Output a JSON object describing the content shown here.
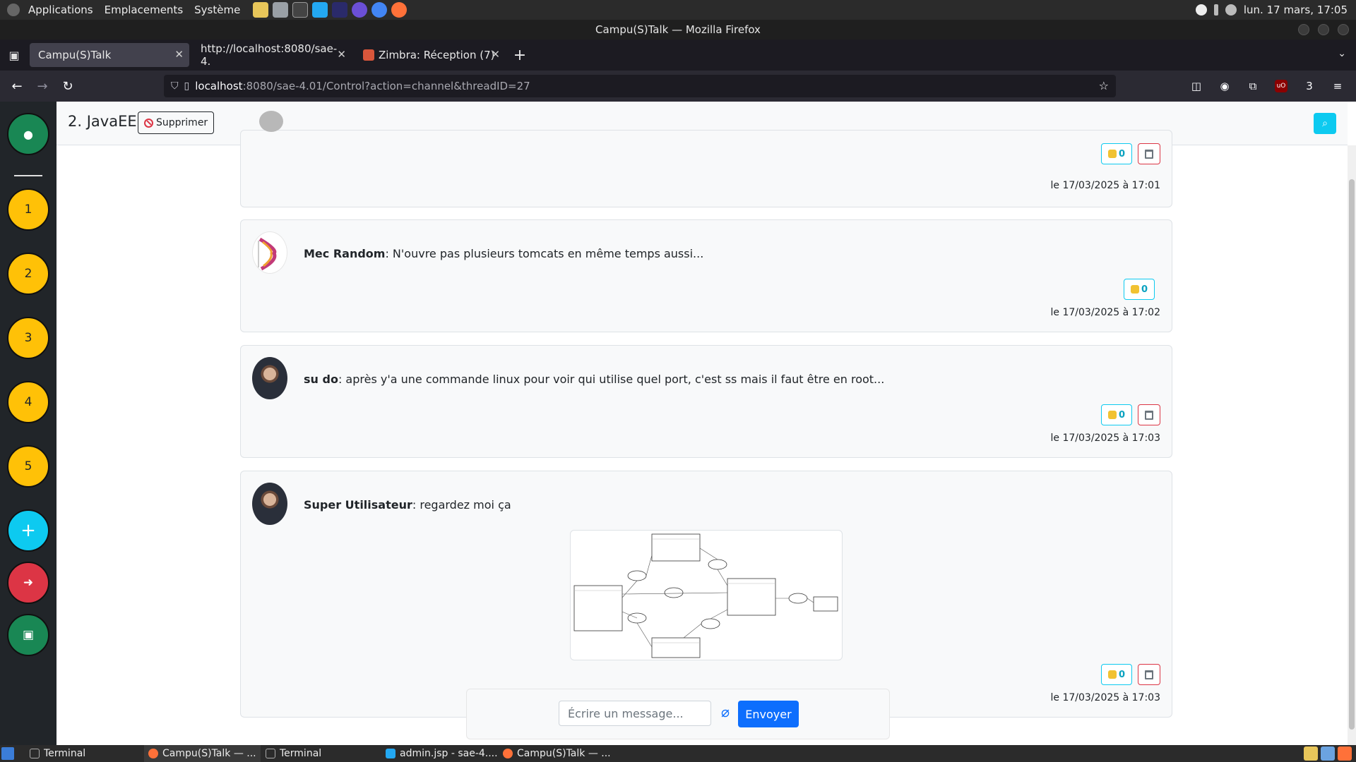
{
  "system": {
    "menu": [
      "Applications",
      "Emplacements",
      "Système"
    ],
    "clock": "lun. 17 mars, 17:05"
  },
  "window": {
    "title": "Campu(S)Talk — Mozilla Firefox"
  },
  "tabs": [
    {
      "label": "Campu(S)Talk",
      "active": true
    },
    {
      "label": "http://localhost:8080/sae-4."
    },
    {
      "label": "Zimbra: Réception (7)"
    }
  ],
  "url": {
    "host": "localhost",
    "rest": ":8080/sae-4.01/Control?action=channel&threadID=27"
  },
  "extensions": {
    "count_badge": "3"
  },
  "sidebar": {
    "channels": [
      "1",
      "2",
      "3",
      "4",
      "5"
    ]
  },
  "channel": {
    "title": "2. JavaEE",
    "delete_label": "Supprimer"
  },
  "messages": [
    {
      "author": "",
      "text": "",
      "likes": "0",
      "date": "le 17/03/2025 à 17:01",
      "deletable": true
    },
    {
      "author": "Mec Random",
      "text": ": N'ouvre pas plusieurs tomcats en même temps aussi...",
      "likes": "0",
      "date": "le 17/03/2025 à 17:02",
      "deletable": false
    },
    {
      "author": "su do",
      "text": ": après y'a une commande linux pour voir qui utilise quel port, c'est ss mais il faut être en root...",
      "likes": "0",
      "date": "le 17/03/2025 à 17:03",
      "deletable": true
    },
    {
      "author": "Super Utilisateur",
      "text": ": regardez moi ça",
      "likes": "0",
      "date": "le 17/03/2025 à 17:03",
      "deletable": true
    }
  ],
  "composer": {
    "placeholder": "Écrire un message...",
    "send_label": "Envoyer"
  },
  "taskbar": {
    "items": [
      "Terminal",
      "Campu(S)Talk — ...",
      "Terminal",
      "admin.jsp - sae-4....",
      "Campu(S)Talk — ..."
    ]
  },
  "colors": {
    "sidebar_bg": "#212529",
    "profile": "#198754",
    "channel": "#ffc107",
    "add": "#0dcaf0",
    "logout": "#dc3545",
    "primary": "#0d6efd"
  }
}
